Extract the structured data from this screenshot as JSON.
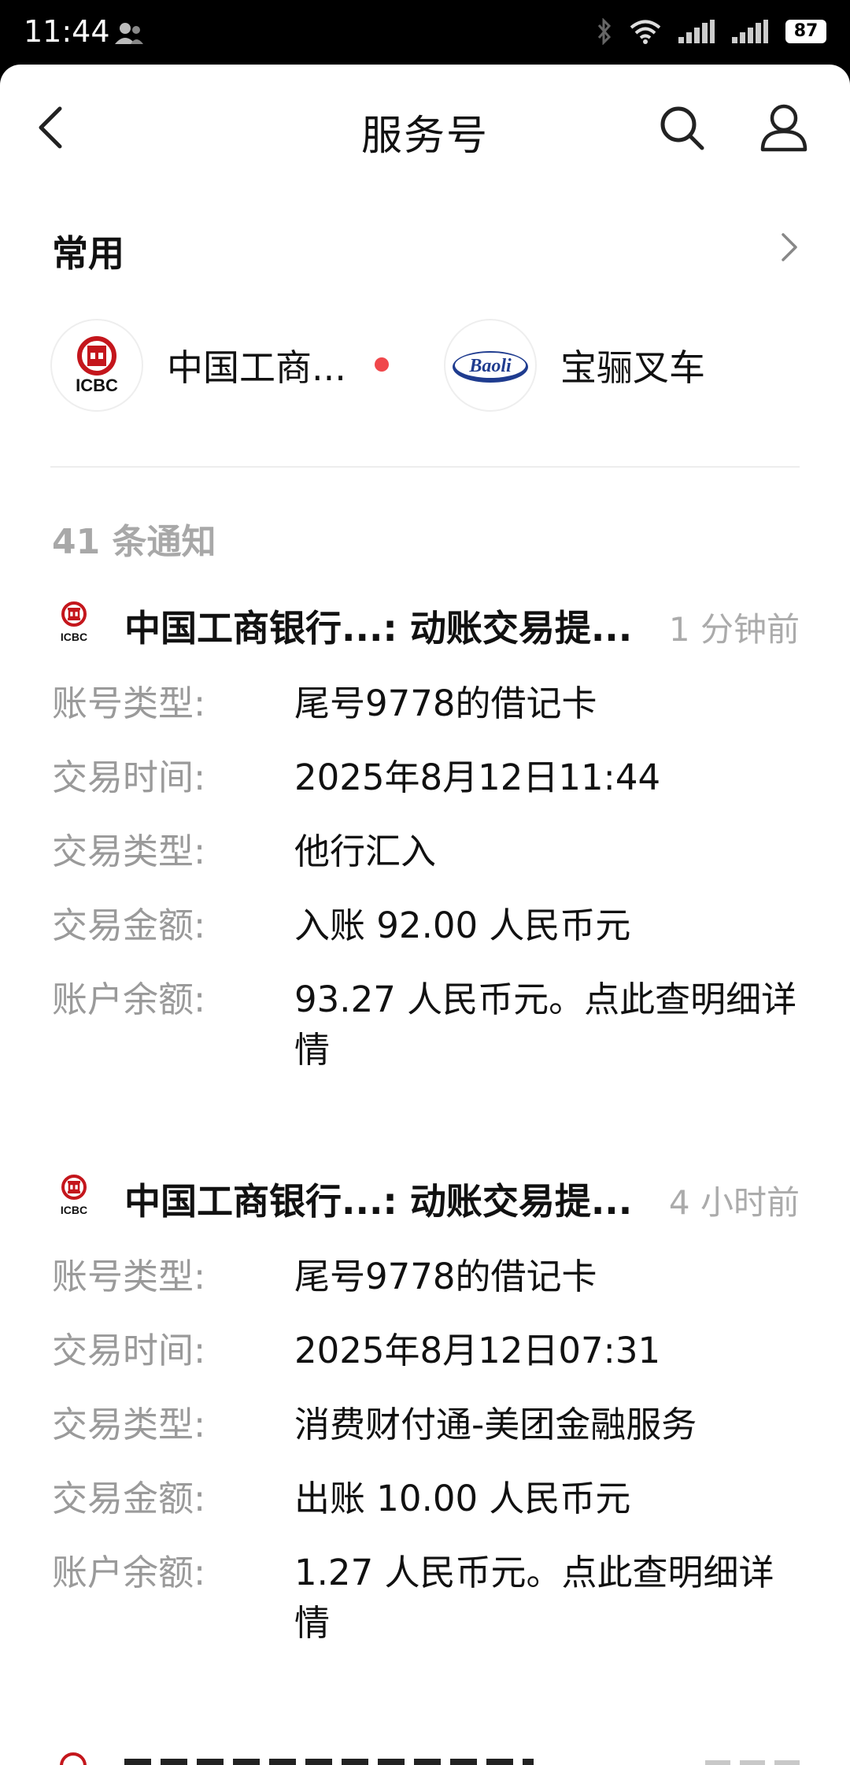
{
  "status_bar": {
    "time": "11:44",
    "battery": "87"
  },
  "nav": {
    "title": "服务号",
    "back_icon": "back-arrow-icon",
    "search_icon": "search-icon",
    "profile_icon": "person-icon"
  },
  "frequent": {
    "title": "常用",
    "items": [
      {
        "name": "中国工商...",
        "logo_text": "ICBC",
        "logo_color": "#c4161c",
        "unread": true
      },
      {
        "name": "宝骊叉车",
        "logo_text": "Baoli",
        "logo_color": "#1f3c8f",
        "unread": false
      }
    ]
  },
  "notification_count": "41 条通知",
  "messages": [
    {
      "title": "中国工商银行...: 动账交易提...",
      "time": "1 分钟前",
      "logo_text": "ICBC",
      "rows": [
        {
          "label": "账号类型:",
          "value": "尾号9778的借记卡"
        },
        {
          "label": "交易时间:",
          "value": "2025年8月12日11:44"
        },
        {
          "label": "交易类型:",
          "value": "他行汇入"
        },
        {
          "label": "交易金额:",
          "value": "入账 92.00 人民币元"
        },
        {
          "label": "账户余额:",
          "value": "93.27 人民币元。点此查明细详情"
        }
      ]
    },
    {
      "title": "中国工商银行...: 动账交易提...",
      "time": "4 小时前",
      "logo_text": "ICBC",
      "rows": [
        {
          "label": "账号类型:",
          "value": "尾号9778的借记卡"
        },
        {
          "label": "交易时间:",
          "value": "2025年8月12日07:31"
        },
        {
          "label": "交易类型:",
          "value": "消费财付通-美团金融服务"
        },
        {
          "label": "交易金额:",
          "value": "出账 10.00 人民币元"
        },
        {
          "label": "账户余额:",
          "value": "1.27 人民币元。点此查明细详情"
        }
      ]
    }
  ]
}
